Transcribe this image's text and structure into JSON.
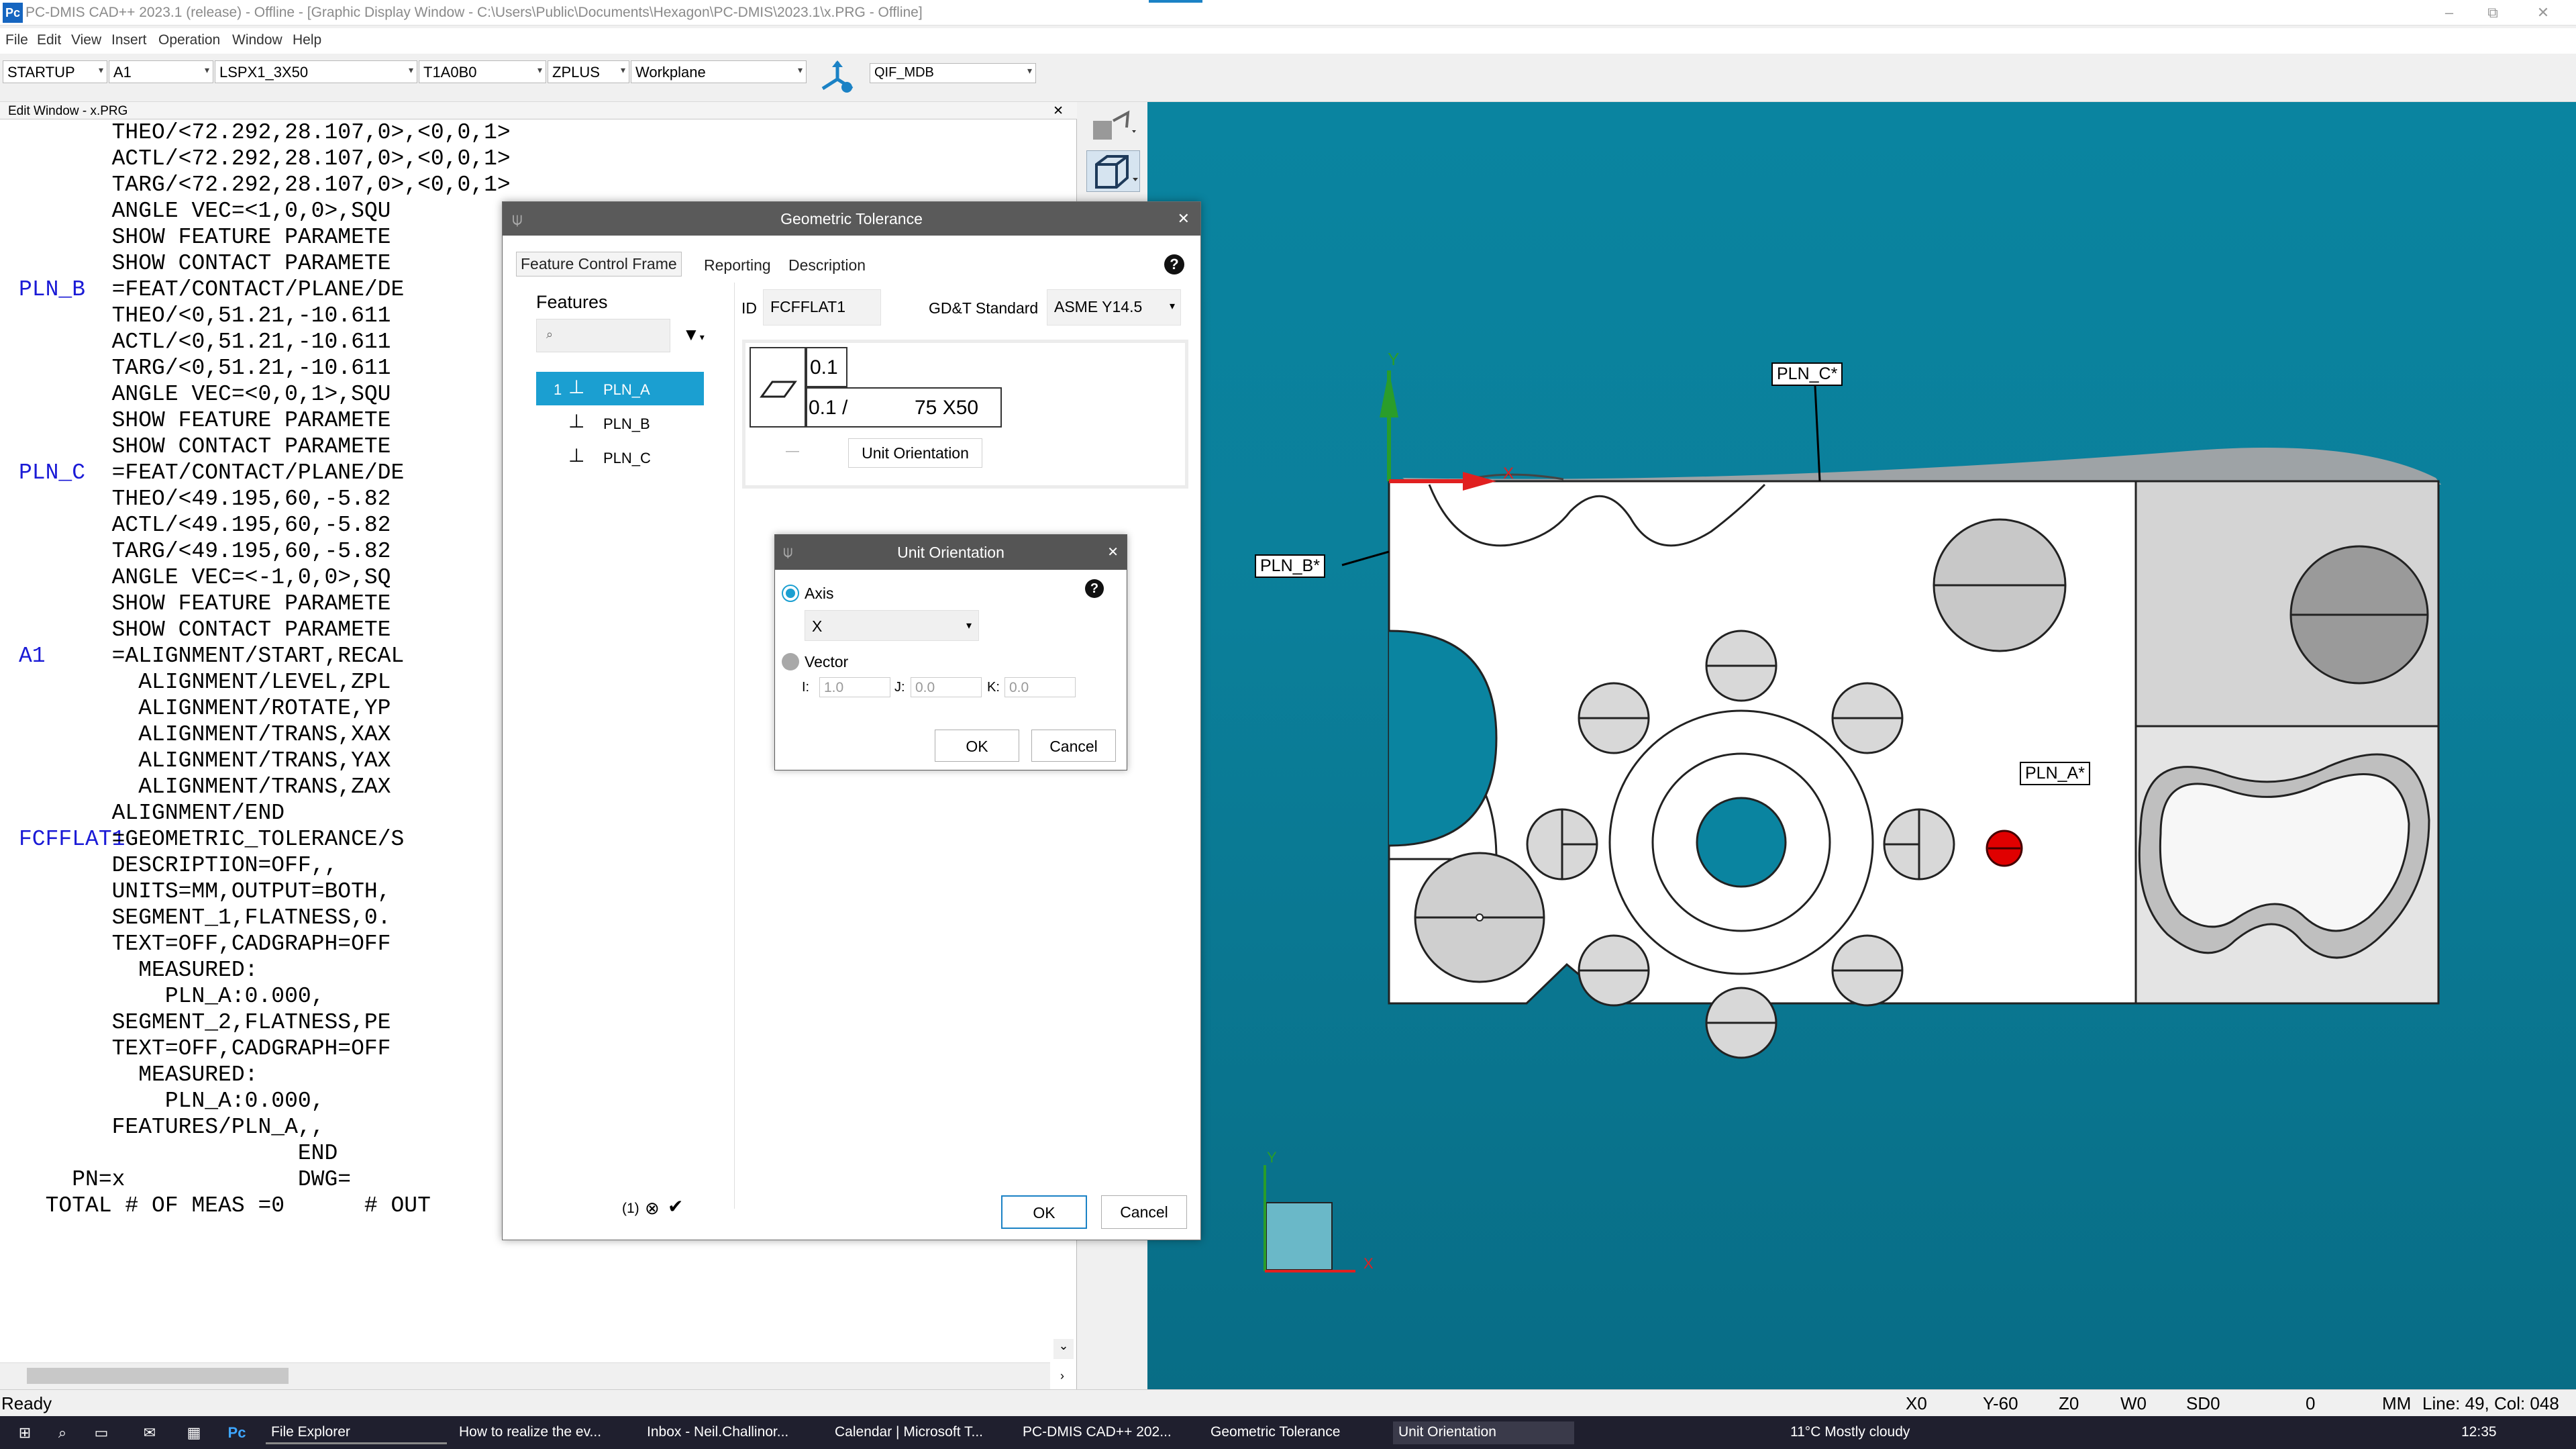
{
  "window": {
    "app_icon": "Pc",
    "title": "PC-DMIS CAD++ 2023.1 (release) - Offline - [Graphic Display Window - C:\\Users\\Public\\Documents\\Hexagon\\PC-DMIS\\2023.1\\x.PRG - Offline]",
    "minimize": "–",
    "restore": "⧉",
    "close": "✕"
  },
  "menu": [
    "File",
    "Edit",
    "View",
    "Insert",
    "Operation",
    "Window",
    "Help"
  ],
  "toolbar": {
    "probe_file": "STARTUP",
    "alignment": "A1",
    "probe": "LSPX1_3X50",
    "tip": "T1A0B0",
    "workplane_dir": "ZPLUS",
    "workplane": "Workplane",
    "qif": "QIF_MDB"
  },
  "edit_window": {
    "title": "Edit Window - x.PRG",
    "close": "✕",
    "lines": [
      {
        "label": "",
        "text": "       THEO/<72.292,28.107,0>,<0,0,1>"
      },
      {
        "label": "",
        "text": "       ACTL/<72.292,28.107,0>,<0,0,1>"
      },
      {
        "label": "",
        "text": "       TARG/<72.292,28.107,0>,<0,0,1>"
      },
      {
        "label": "",
        "text": "       ANGLE VEC=<1,0,0>,SQU"
      },
      {
        "label": "",
        "text": "       SHOW FEATURE PARAMETE"
      },
      {
        "label": "",
        "text": "       SHOW CONTACT PARAMETE"
      },
      {
        "label": "PLN_B",
        "text": "       =FEAT/CONTACT/PLANE/DE"
      },
      {
        "label": "",
        "text": "       THEO/<0,51.21,-10.611"
      },
      {
        "label": "",
        "text": "       ACTL/<0,51.21,-10.611"
      },
      {
        "label": "",
        "text": "       TARG/<0,51.21,-10.611"
      },
      {
        "label": "",
        "text": "       ANGLE VEC=<0,0,1>,SQU"
      },
      {
        "label": "",
        "text": "       SHOW FEATURE PARAMETE"
      },
      {
        "label": "",
        "text": "       SHOW CONTACT PARAMETE"
      },
      {
        "label": "PLN_C",
        "text": "       =FEAT/CONTACT/PLANE/DE"
      },
      {
        "label": "",
        "text": "       THEO/<49.195,60,-5.82"
      },
      {
        "label": "",
        "text": "       ACTL/<49.195,60,-5.82"
      },
      {
        "label": "",
        "text": "       TARG/<49.195,60,-5.82"
      },
      {
        "label": "",
        "text": "       ANGLE VEC=<-1,0,0>,SQ"
      },
      {
        "label": "",
        "text": "       SHOW FEATURE PARAMETE"
      },
      {
        "label": "",
        "text": "       SHOW CONTACT PARAMETE"
      },
      {
        "label": "A1",
        "text": "       =ALIGNMENT/START,RECAL"
      },
      {
        "label": "",
        "text": "         ALIGNMENT/LEVEL,ZPL"
      },
      {
        "label": "",
        "text": "         ALIGNMENT/ROTATE,YP"
      },
      {
        "label": "",
        "text": "         ALIGNMENT/TRANS,XAX"
      },
      {
        "label": "",
        "text": "         ALIGNMENT/TRANS,YAX"
      },
      {
        "label": "",
        "text": "         ALIGNMENT/TRANS,ZAX"
      },
      {
        "label": "",
        "text": "       ALIGNMENT/END"
      },
      {
        "label": "FCFFLAT1",
        "text": "       =GEOMETRIC_TOLERANCE/S"
      },
      {
        "label": "",
        "text": "       DESCRIPTION=OFF,,"
      },
      {
        "label": "",
        "text": "       UNITS=MM,OUTPUT=BOTH,"
      },
      {
        "label": "",
        "text": "       SEGMENT_1,FLATNESS,0."
      },
      {
        "label": "",
        "text": "       TEXT=OFF,CADGRAPH=OFF"
      },
      {
        "label": "",
        "text": "         MEASURED:"
      },
      {
        "label": "",
        "text": "           PLN_A:0.000,"
      },
      {
        "label": "",
        "text": "       SEGMENT_2,FLATNESS,PE"
      },
      {
        "label": "",
        "text": "       TEXT=OFF,CADGRAPH=OFF"
      },
      {
        "label": "",
        "text": "         MEASURED:"
      },
      {
        "label": "",
        "text": "           PLN_A:0.000,"
      },
      {
        "label": "",
        "text": "       FEATURES/PLN_A,,"
      },
      {
        "label": "",
        "text": "                     END"
      },
      {
        "label": "",
        "text": "    PN=x             DWG="
      },
      {
        "label": "",
        "text": "  TOTAL # OF MEAS =0      # OUT"
      }
    ]
  },
  "geometric_tolerance": {
    "title": "Geometric Tolerance",
    "close": "✕",
    "tabs": [
      "Feature Control Frame",
      "Reporting",
      "Description"
    ],
    "help": "?",
    "features_label": "Features",
    "features": [
      {
        "index": "1",
        "name": "PLN_A"
      },
      {
        "index": "",
        "name": "PLN_B"
      },
      {
        "index": "",
        "name": "PLN_C"
      }
    ],
    "footer_count": "(1)",
    "id_label": "ID",
    "id_value": "FCFFLAT1",
    "gdt_label": "GD&T Standard",
    "gdt_value": "ASME Y14.5",
    "fcf_row1": "0.1",
    "fcf_row2_a": "0.1 /",
    "fcf_row2_b": "75 X50",
    "fcf_dash": "—",
    "unit_orientation_btn": "Unit Orientation",
    "ok": "OK",
    "cancel": "Cancel"
  },
  "unit_orientation": {
    "title": "Unit Orientation",
    "close": "✕",
    "help": "?",
    "axis_label": "Axis",
    "axis_value": "X",
    "vector_label": "Vector",
    "i_label": "I:",
    "i_value": "1.0",
    "j_label": "J:",
    "j_value": "0.0",
    "k_label": "K:",
    "k_value": "0.0",
    "ok": "OK",
    "cancel": "Cancel"
  },
  "model_labels": {
    "plan_a": "PLN_A*",
    "plan_b": "PLN_B*",
    "plan_c": "PLN_C*",
    "axis_y": "Y",
    "axis_x": "X",
    "mini_y": "Y",
    "mini_x": "X"
  },
  "status": {
    "ready": "Ready",
    "x": "X0",
    "y": "Y-60",
    "z": "Z0",
    "w": "W0",
    "sd": "SD0",
    "zero": "0",
    "units": "MM",
    "position": "Line: 49, Col: 048"
  },
  "taskbar": {
    "items": [
      "File Explorer",
      "How to realize the ev...",
      "Inbox - Neil.Challinor...",
      "Calendar | Microsoft T...",
      "PC-DMIS CAD++ 202...",
      "Geometric Tolerance",
      "Unit Orientation"
    ],
    "weather": "11°C  Mostly cloudy",
    "time": "12:35"
  },
  "colors": {
    "accent": "#1b9fd1",
    "viewport": "#0a84a0",
    "code_blue": "#1a1ad6",
    "red_marker": "#e00000",
    "dialog_title": "#5a5a5a"
  }
}
